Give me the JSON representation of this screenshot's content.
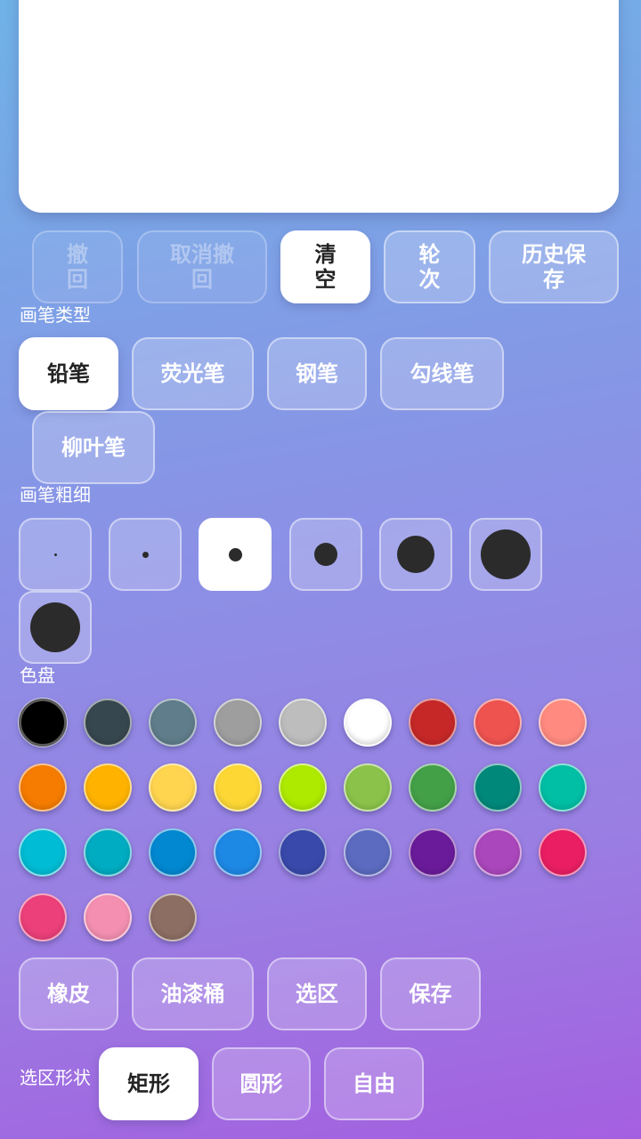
{
  "toolbar": {
    "undo": "撤\n回",
    "redo": "取消撤\n回",
    "clear": "清\n空",
    "rounds": "轮\n次",
    "history_save": "历史保\n存"
  },
  "brush_type": {
    "label": "画笔类型",
    "options": [
      "铅笔",
      "荧光笔",
      "钢笔",
      "勾线笔",
      "柳叶笔"
    ],
    "selected": "铅笔"
  },
  "brush_size": {
    "label": "画笔粗细",
    "sizes": [
      3,
      7,
      15,
      26,
      42,
      56,
      56
    ],
    "selected_index": 2
  },
  "palette": {
    "label": "色盘",
    "colors": [
      "#000000",
      "#37474f",
      "#607d8b",
      "#9e9e9e",
      "#bdbdbd",
      "#ffffff",
      "#c62828",
      "#ef5350",
      "#ff8a80",
      "#f57c00",
      "#ffb300",
      "#ffd54f",
      "#fdd835",
      "#aeea00",
      "#8bc34a",
      "#43a047",
      "#00897b",
      "#00bfa5",
      "#00bcd4",
      "#00acc1",
      "#0288d1",
      "#1e88e5",
      "#3949ab",
      "#5c6bc0",
      "#6a1b9a",
      "#ab47bc",
      "#e91e63",
      "#ec407a",
      "#f48fb1",
      "#8d6e63"
    ],
    "selected_index": 0
  },
  "tools": {
    "eraser": "橡皮",
    "bucket": "油漆桶",
    "selection": "选区",
    "save": "保存"
  },
  "selection_shape": {
    "label": "选区形状",
    "options": [
      "矩形",
      "圆形",
      "自由"
    ],
    "selected": "矩形"
  }
}
